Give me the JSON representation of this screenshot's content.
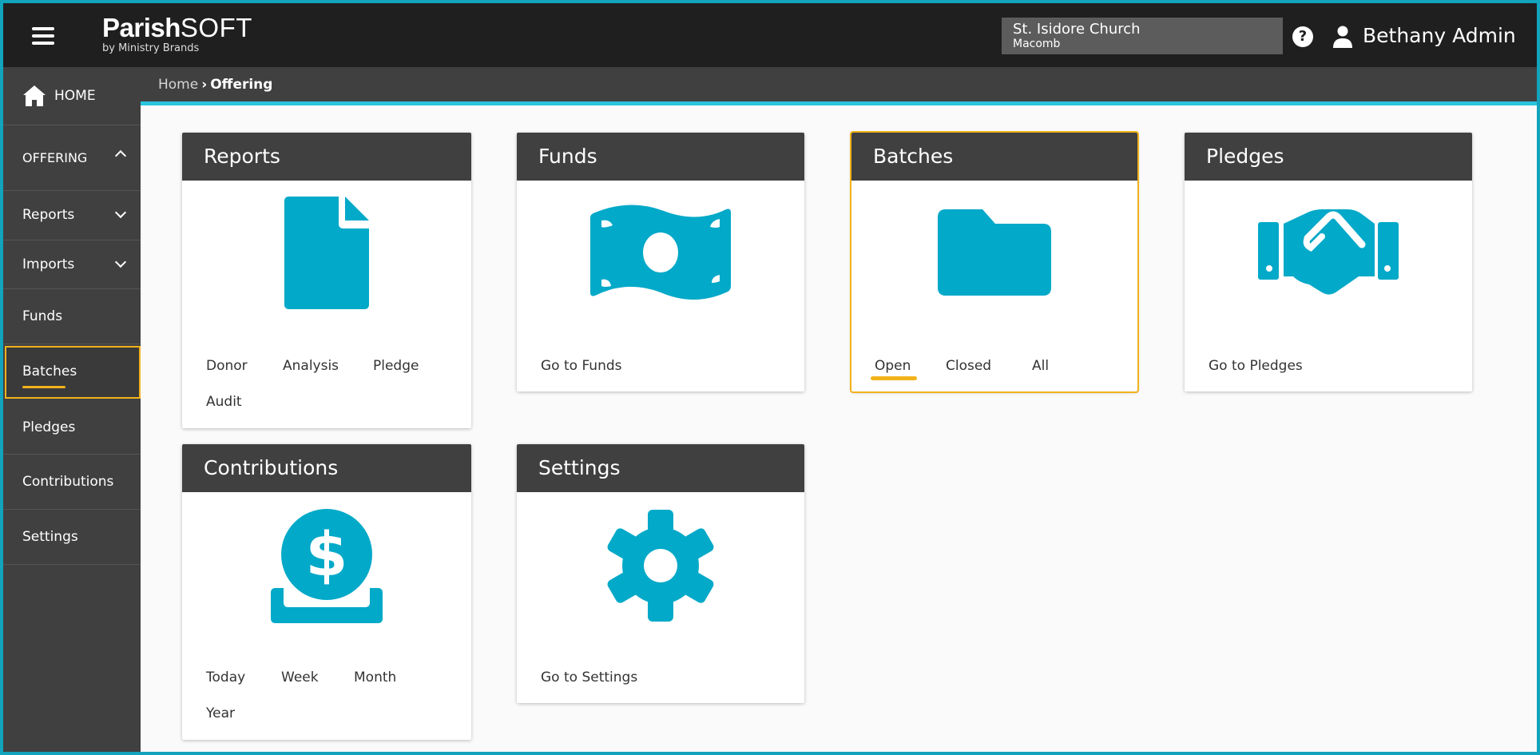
{
  "header": {
    "logo_main_1": "Parish",
    "logo_main_2": "SOFT",
    "logo_sub": "by Ministry Brands",
    "church_name": "St. Isidore Church",
    "church_city": "Macomb",
    "help": "?",
    "user_name": "Bethany Admin"
  },
  "colors": {
    "accent": "#12a3bd",
    "icon": "#03a9c8",
    "focus": "#f2b21b",
    "dark": "#404040"
  },
  "sidebar": {
    "items": [
      {
        "label": "HOME"
      },
      {
        "label": "OFFERING"
      },
      {
        "label": "Reports"
      },
      {
        "label": "Imports"
      },
      {
        "label": "Funds"
      },
      {
        "label": "Batches"
      },
      {
        "label": "Pledges"
      },
      {
        "label": "Contributions"
      },
      {
        "label": "Settings"
      }
    ]
  },
  "breadcrumb": {
    "home": "Home",
    "current": "Offering"
  },
  "cards": {
    "reports": {
      "title": "Reports",
      "icon": "document-icon",
      "links": [
        "Donor",
        "Analysis",
        "Pledge",
        "Audit"
      ]
    },
    "funds": {
      "title": "Funds",
      "icon": "money-bill-icon",
      "links": [
        "Go to Funds"
      ]
    },
    "batches": {
      "title": "Batches",
      "icon": "folder-icon",
      "links": [
        "Open",
        "Closed",
        "All"
      ]
    },
    "pledges": {
      "title": "Pledges",
      "icon": "handshake-icon",
      "links": [
        "Go to Pledges"
      ]
    },
    "contributions": {
      "title": "Contributions",
      "icon": "donate-icon",
      "links": [
        "Today",
        "Week",
        "Month",
        "Year"
      ]
    },
    "settings": {
      "title": "Settings",
      "icon": "gear-icon",
      "links": [
        "Go to Settings"
      ]
    }
  }
}
